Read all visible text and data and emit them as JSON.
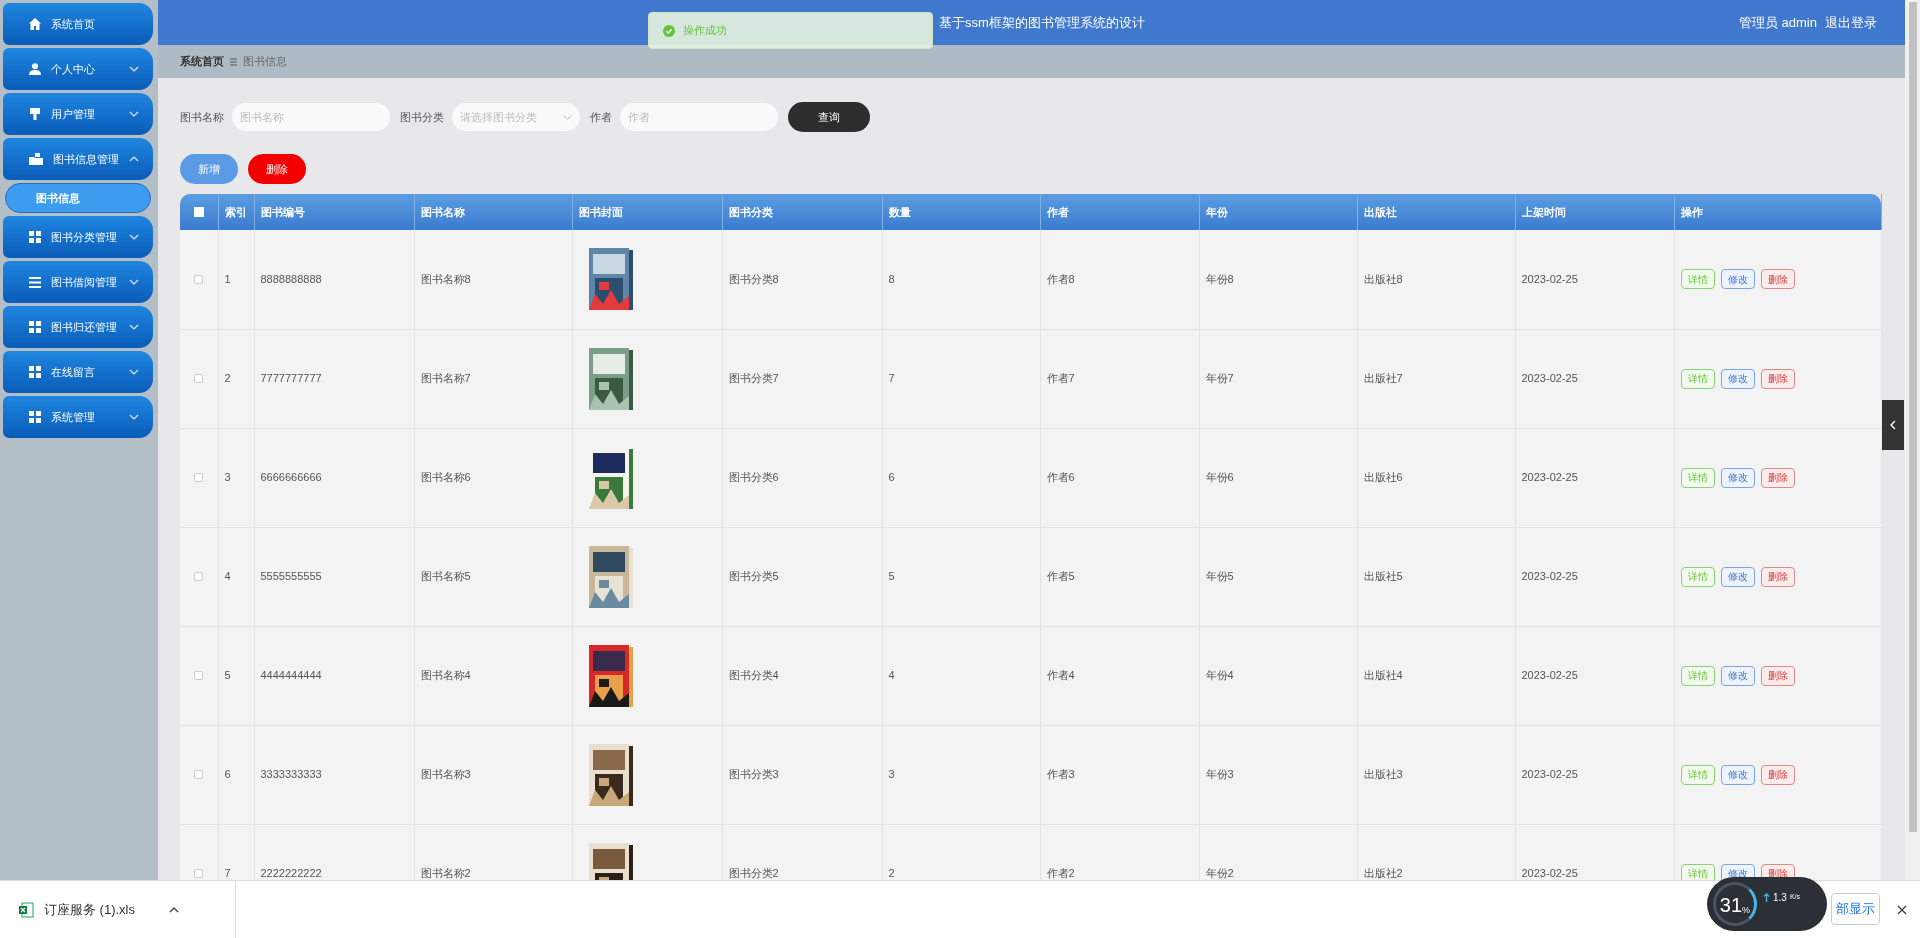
{
  "sidebar": {
    "items": [
      {
        "label": "系统首页",
        "kind": "link",
        "selected": false
      },
      {
        "label": "个人中心",
        "kind": "menu",
        "expanded": false,
        "selected": false
      },
      {
        "label": "用户管理",
        "kind": "menu",
        "expanded": false,
        "selected": false
      },
      {
        "label": "图书信息管理",
        "kind": "menu",
        "expanded": true,
        "selected": false,
        "children": [
          {
            "label": "图书信息",
            "selected": true
          }
        ]
      },
      {
        "label": "图书分类管理",
        "kind": "menu",
        "expanded": false,
        "selected": false
      },
      {
        "label": "图书借阅管理",
        "kind": "menu",
        "expanded": false,
        "selected": false
      },
      {
        "label": "图书归还管理",
        "kind": "menu",
        "expanded": false,
        "selected": false
      },
      {
        "label": "在线留言",
        "kind": "menu",
        "expanded": false,
        "selected": false
      },
      {
        "label": "系统管理",
        "kind": "menu",
        "expanded": false,
        "selected": false
      }
    ]
  },
  "header": {
    "title": "基于ssm框架的图书管理系统的设计",
    "user": "管理员 admin",
    "logout": "退出登录"
  },
  "toast": {
    "message": "操作成功"
  },
  "breadcrumb": [
    "系统首页",
    "图书信息"
  ],
  "search": {
    "fields": [
      {
        "label": "图书名称",
        "placeholder": "图书名称",
        "kind": "text"
      },
      {
        "label": "图书分类",
        "placeholder": "请选择图书分类",
        "kind": "select"
      },
      {
        "label": "作者",
        "placeholder": "作者",
        "kind": "text"
      }
    ],
    "button": "查询"
  },
  "actions": [
    "新增",
    "删除"
  ],
  "table": {
    "header_checked": false,
    "columns": [
      "索引",
      "图书编号",
      "图书名称",
      "图书封面",
      "图书分类",
      "数量",
      "作者",
      "年份",
      "出版社",
      "上架时间",
      "操作"
    ],
    "rows": [
      {
        "checked": false,
        "cells": [
          "1",
          "8888888888",
          "图书名称8",
          "",
          "图书分类8",
          "8",
          "作者8",
          "年份8",
          "出版社8",
          "2023-02-25"
        ],
        "actions": [
          "详情",
          "修改",
          "删除"
        ]
      },
      {
        "checked": false,
        "cells": [
          "2",
          "7777777777",
          "图书名称7",
          "",
          "图书分类7",
          "7",
          "作者7",
          "年份7",
          "出版社7",
          "2023-02-25"
        ],
        "actions": [
          "详情",
          "修改",
          "删除"
        ]
      },
      {
        "checked": false,
        "cells": [
          "3",
          "6666666666",
          "图书名称6",
          "",
          "图书分类6",
          "6",
          "作者6",
          "年份6",
          "出版社6",
          "2023-02-25"
        ],
        "actions": [
          "详情",
          "修改",
          "删除"
        ]
      },
      {
        "checked": false,
        "cells": [
          "4",
          "5555555555",
          "图书名称5",
          "",
          "图书分类5",
          "5",
          "作者5",
          "年份5",
          "出版社5",
          "2023-02-25"
        ],
        "actions": [
          "详情",
          "修改",
          "删除"
        ]
      },
      {
        "checked": false,
        "cells": [
          "5",
          "4444444444",
          "图书名称4",
          "",
          "图书分类4",
          "4",
          "作者4",
          "年份4",
          "出版社4",
          "2023-02-25"
        ],
        "actions": [
          "详情",
          "修改",
          "删除"
        ]
      },
      {
        "checked": false,
        "cells": [
          "6",
          "3333333333",
          "图书名称3",
          "",
          "图书分类3",
          "3",
          "作者3",
          "年份3",
          "出版社3",
          "2023-02-25"
        ],
        "actions": [
          "详情",
          "修改",
          "删除"
        ]
      },
      {
        "checked": false,
        "cells": [
          "7",
          "2222222222",
          "图书名称2",
          "",
          "图书分类2",
          "2",
          "作者2",
          "年份2",
          "出版社2",
          "2023-02-25"
        ],
        "actions": [
          "详情",
          "修改",
          "删除"
        ]
      }
    ]
  },
  "download_bar": {
    "file": "订座服务 (1).xls",
    "show_all": "部显示"
  },
  "speed_widget": {
    "percent": "31",
    "unit": "%",
    "speed": "1.3",
    "speed_unit": "K/s"
  }
}
